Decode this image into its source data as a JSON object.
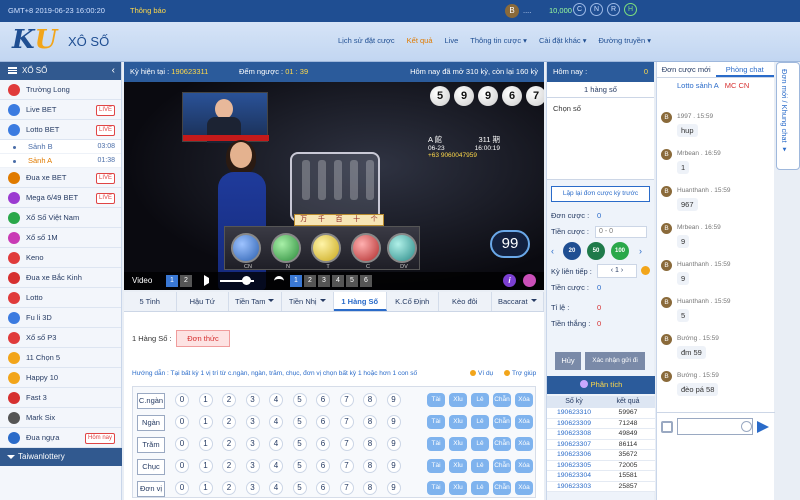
{
  "topbar": {
    "time": "GMT+8 2019-06-23 16:00:20",
    "notice": "Thông báo",
    "avatar_letter": "B",
    "user": "....",
    "balance": "10,000",
    "circles": [
      "C",
      "N",
      "R",
      "H"
    ]
  },
  "header": {
    "logo_k": "K",
    "logo_u": "U",
    "site_name": "XÔ SỐ",
    "nav": [
      "Lịch sử đặt cược",
      "Kết quả",
      "Live",
      "Thông tin cược ▾",
      "Cài đặt khác ▾",
      "Đường truyền ▾"
    ]
  },
  "sidebar": {
    "title": "XỔ SỐ",
    "items": [
      {
        "label": "Trường Long",
        "color": "#e03b3b"
      },
      {
        "label": "Live BET",
        "color": "#3b7be0",
        "badge": "LIVE"
      },
      {
        "label": "Lotto BET",
        "color": "#3b7be0",
        "badge": "LIVE"
      },
      {
        "label": "Sảnh B",
        "sub": true,
        "time": "03:08"
      },
      {
        "label": "Sảnh A",
        "sub": true,
        "time": "01:38",
        "active": true
      },
      {
        "label": "Đua xe BET",
        "color": "#e07b00",
        "badge": "LIVE"
      },
      {
        "label": "Mega 6/49 BET",
        "color": "#9b3bd1",
        "badge": "LIVE"
      },
      {
        "label": "Xổ Số Việt Nam",
        "color": "#2aa84a"
      },
      {
        "label": "Xổ số 1M",
        "color": "#c93bb5"
      },
      {
        "label": "Keno",
        "color": "#e03b3b"
      },
      {
        "label": "Đua xe Bắc Kinh",
        "color": "#d63030"
      },
      {
        "label": "Lotto",
        "color": "#e03b3b"
      },
      {
        "label": "Fu li 3D",
        "color": "#3b7be0"
      },
      {
        "label": "Xổ số P3",
        "color": "#e03b3b"
      },
      {
        "label": "11 Chọn 5",
        "color": "#f2a51a"
      },
      {
        "label": "Happy 10",
        "color": "#f2a51a"
      },
      {
        "label": "Fast 3",
        "color": "#d63030"
      },
      {
        "label": "Mark Six",
        "color": "#555"
      },
      {
        "label": "Đua ngựa",
        "color": "#2a6bc9",
        "badge": "Hôm nay"
      }
    ],
    "footer": "Taiwanlottery"
  },
  "gamebar": {
    "ky_label": "Kỳ hiện tại :",
    "ky_value": "190623311",
    "countdown_label": "Đếm ngược :",
    "countdown_value": "01 : 39",
    "today_text": "Hôm nay đã mở 310 kỳ, còn lại 160 kỳ"
  },
  "video": {
    "balls": [
      "5",
      "9",
      "9",
      "6",
      "7"
    ],
    "board_a": "A 館",
    "board_period": "311 期",
    "board_date": "06-23",
    "board_time": "16:00:19",
    "board_phone": "+63 9060047959",
    "hanzi": [
      "万",
      "千",
      "百",
      "十",
      "个"
    ],
    "tray_labels": [
      "CN",
      "N",
      "T",
      "C",
      "DV"
    ],
    "round": "99",
    "label": "Video",
    "cams": [
      "1",
      "2"
    ],
    "sources": [
      "1",
      "2",
      "3",
      "4",
      "5",
      "6"
    ]
  },
  "bet": {
    "tabs": [
      "5 Tinh",
      "Hậu Tứ",
      "Tiền Tam",
      "Tiền Nhị",
      "1 Hàng Số",
      "K.Cố Định",
      "Kèo đôi",
      "Baccarat"
    ],
    "subline": "1 Hàng Số :",
    "don_thuc": "Đơn thức",
    "guide": "Hướng dẫn : Tại bất kỳ 1 vị trí từ c.ngàn, ngàn, trăm, chục, đơn vị chọn bất kỳ 1 hoặc hơn 1 con số",
    "vidu": "Ví dụ",
    "trogiup": "Trợ giúp",
    "rows": [
      "C.ngàn",
      "Ngàn",
      "Trăm",
      "Chục",
      "Đơn vị"
    ],
    "numbers": [
      "0",
      "1",
      "2",
      "3",
      "4",
      "5",
      "6",
      "7",
      "8",
      "9"
    ],
    "quick": [
      "Tài",
      "Xỉu",
      "Lẻ",
      "Chẵn",
      "Xóa"
    ]
  },
  "middle": {
    "header": "Hôm nay :",
    "header_value": "0",
    "title": "1 hàng số",
    "chon_so": "Chọn số",
    "lap_lai": "Lặp lại đơn cược kỳ trước",
    "don_cuoc_label": "Đơn cược :",
    "don_cuoc_value": "0",
    "tien_cuoc_label": "Tiền cược :",
    "tien_cuoc_value": "0 - 0",
    "chips": [
      "20",
      "50",
      "100"
    ],
    "ky_tiep_label": "Kỳ liên tiếp :",
    "ky_tiep_value": "1",
    "tien_cuoc2_label": "Tiền cược :",
    "tien_cuoc2_value": "0",
    "ti_le_label": "Tỉ     lệ :",
    "ti_le_value": "0",
    "tien_thang_label": "Tiền thắng :",
    "tien_thang_value": "0",
    "huy": "Hủy",
    "xac_nhan": "Xác nhận gửi đi",
    "phan_tich": "Phân tích",
    "result_headers": [
      "Số kỳ",
      "kết quả"
    ],
    "results": [
      [
        "190623310",
        "59967"
      ],
      [
        "190623309",
        "71248"
      ],
      [
        "190623308",
        "49849"
      ],
      [
        "190623307",
        "86114"
      ],
      [
        "190623306",
        "35672"
      ],
      [
        "190623305",
        "72005"
      ],
      [
        "190623304",
        "15581"
      ],
      [
        "190623303",
        "25857"
      ]
    ]
  },
  "chat": {
    "tabs": [
      "Đơn cược mới",
      "Phòng chat"
    ],
    "room": "Lotto sảnh A",
    "mc": "MC CN",
    "messages": [
      {
        "name": "1997 . 15:59",
        "text": "hup"
      },
      {
        "name": "Mrbean . 16:59",
        "text": "1"
      },
      {
        "name": "Huanthanh . 15:59",
        "text": "967"
      },
      {
        "name": "Mrbean . 16:59",
        "text": "9"
      },
      {
        "name": "Huanthanh . 15:59",
        "text": "9"
      },
      {
        "name": "Huanthanh . 15:59",
        "text": "5"
      },
      {
        "name": "Bướng . 15:59",
        "text": "đm 59"
      },
      {
        "name": "Bướng . 15:59",
        "text": "đèo pá 58"
      }
    ]
  },
  "vtab": "Đơn mới / Khung chat ▾"
}
